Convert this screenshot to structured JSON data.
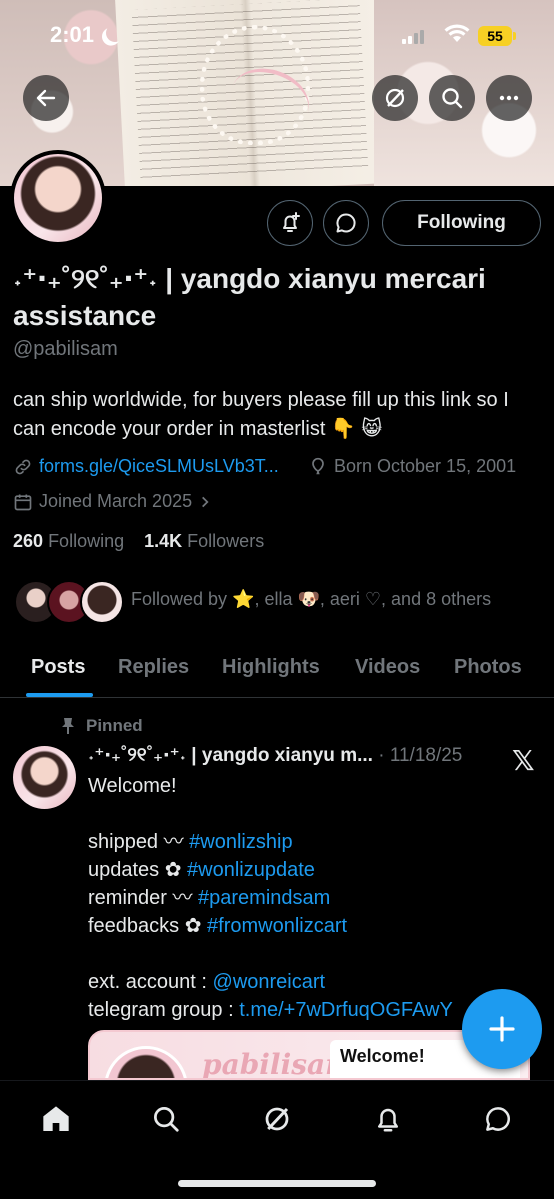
{
  "status_bar": {
    "time": "2:01",
    "battery": "55"
  },
  "header": {
    "back_icon": "arrow-left-icon",
    "grok_icon": "grok-icon",
    "search_icon": "search-icon",
    "more_icon": "more-icon"
  },
  "profile": {
    "display_name": "˖⁺‧₊˚୨୧˚₊‧⁺˖ | yangdo xianyu mercari assistance",
    "handle": "@pabilisam",
    "following_button": "Following",
    "bio": "can ship worldwide, for buyers please fill up this link so I can encode your order in masterlist 👇 😸",
    "link": "forms.gle/QiceSLMUsLVb3T...",
    "birthday": "Born October 15, 2001",
    "joined": "Joined March 2025",
    "following_count": "260",
    "following_label": "Following",
    "followers_count": "1.4K",
    "followers_label": "Followers",
    "followed_by": "Followed by ⭐, ella 🐶, aeri ♡, and 8 others"
  },
  "tabs": [
    "Posts",
    "Replies",
    "Highlights",
    "Videos",
    "Photos"
  ],
  "pinned_post": {
    "pinned_label": "Pinned",
    "author": "˖⁺‧₊˚୨୧˚₊‧⁺˖ | yangdo xianyu m...",
    "date": "· 11/18/25",
    "greeting": "Welcome!",
    "lines": [
      {
        "prefix": "shipped 〰 ",
        "tag": "#wonlizship"
      },
      {
        "prefix": "updates ✿ ",
        "tag": "#wonlizupdate"
      },
      {
        "prefix": "reminder 〰 ",
        "tag": "#paremindsam"
      },
      {
        "prefix": "feedbacks ✿ ",
        "tag": "#fromwonlizcart"
      }
    ],
    "ext_account_label": "ext. account : ",
    "ext_account": "@wonreicart",
    "telegram_label": "telegram group : ",
    "telegram_link": "t.me/+7wDrfuqOGFAwY",
    "card_name": "pabilisam",
    "card_welcome": "Welcome!"
  },
  "bottom_nav": [
    "home-icon",
    "search-icon",
    "grok-icon",
    "notifications-icon",
    "messages-icon"
  ],
  "colors": {
    "accent": "#1d9bf0",
    "background": "#000000",
    "secondary_text": "#71767b"
  }
}
